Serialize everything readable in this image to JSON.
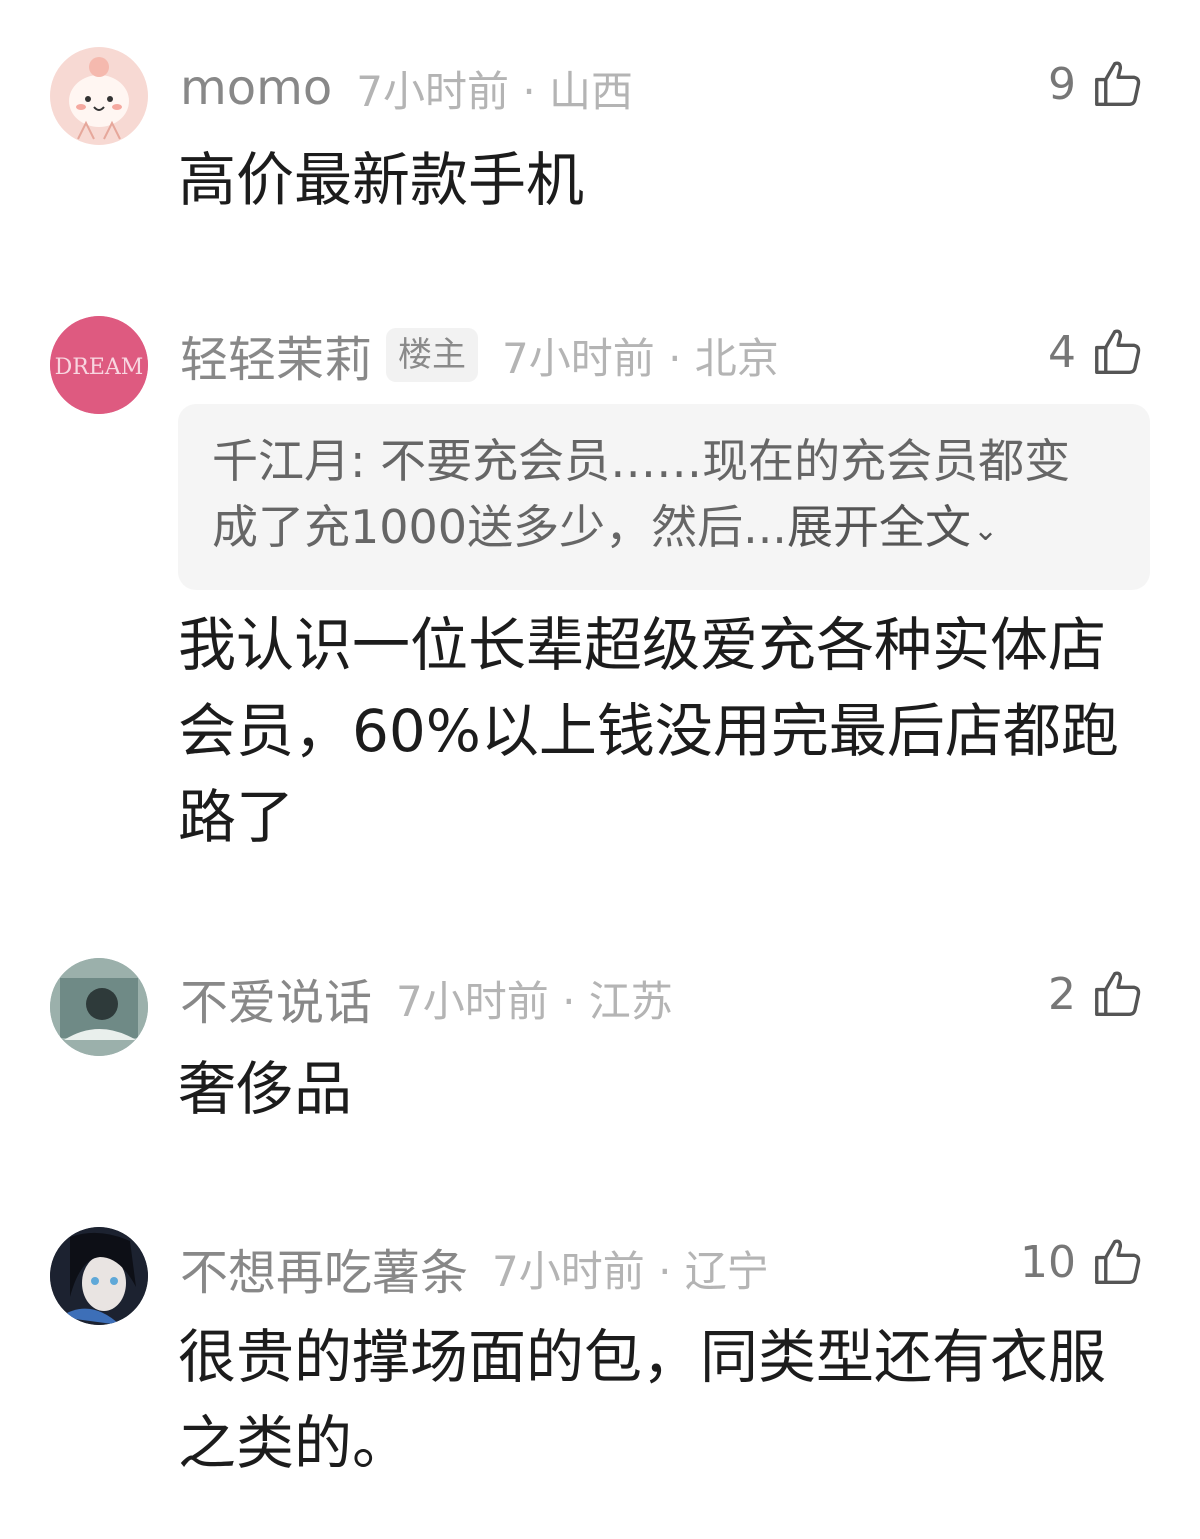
{
  "comments": [
    {
      "user": "momo",
      "meta": "7小时前 · 山西",
      "likes": "9",
      "text": "高价最新款手机"
    },
    {
      "user": "轻轻茉莉",
      "badge": "楼主",
      "meta": "7小时前 · 北京",
      "likes": "4",
      "quote": {
        "author_text": "千江月: 不要充会员……现在的充会员都变成了充1000送多少，然后...",
        "expand_label": "展开全文"
      },
      "text": "我认识一位长辈超级爱充各种实体店会员，60%以上钱没用完最后店都跑路了"
    },
    {
      "user": "不爱说话",
      "meta": "7小时前 · 江苏",
      "likes": "2",
      "text": "奢侈品"
    },
    {
      "user": "不想再吃薯条",
      "meta": "7小时前 · 辽宁",
      "likes": "10",
      "text": "很贵的撑场面的包，同类型还有衣服之类的。"
    }
  ],
  "avatars": {
    "dream_text": "DREAM"
  },
  "icons": {
    "like": "thumbs-up-icon",
    "expand": "chevron-down-icon"
  },
  "colors": {
    "username": "#888888",
    "meta": "#b4b4b4",
    "text": "#1c1c1c",
    "quote_bg": "#f5f5f5"
  }
}
